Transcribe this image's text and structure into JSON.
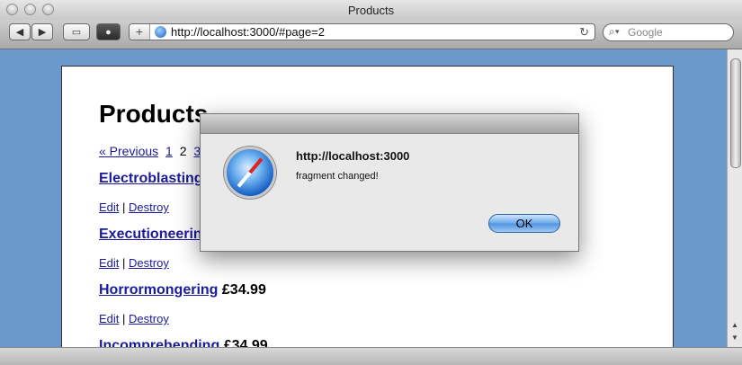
{
  "window": {
    "title": "Products"
  },
  "toolbar": {
    "back_icon": "back-arrow-icon",
    "forward_icon": "forward-arrow-icon",
    "add_label": "+",
    "url": "http://localhost:3000/#page=2",
    "reload_icon": "reload-icon",
    "search_placeholder": "Google"
  },
  "page": {
    "heading": "Products",
    "pager": {
      "prev": "« Previous",
      "pages": [
        "1",
        "2",
        "3"
      ],
      "current": "2"
    },
    "products": [
      {
        "name": "Electroblasting",
        "price": ""
      },
      {
        "name": "Executioneering",
        "price": ""
      },
      {
        "name": "Horrormongering",
        "price": "£34.99"
      },
      {
        "name": "Incomprehending",
        "price": "£34.99"
      }
    ],
    "edit_label": "Edit",
    "separator": "|",
    "destroy_label": "Destroy"
  },
  "dialog": {
    "host": "http://localhost:3000",
    "message": "fragment changed!",
    "ok_label": "OK"
  }
}
